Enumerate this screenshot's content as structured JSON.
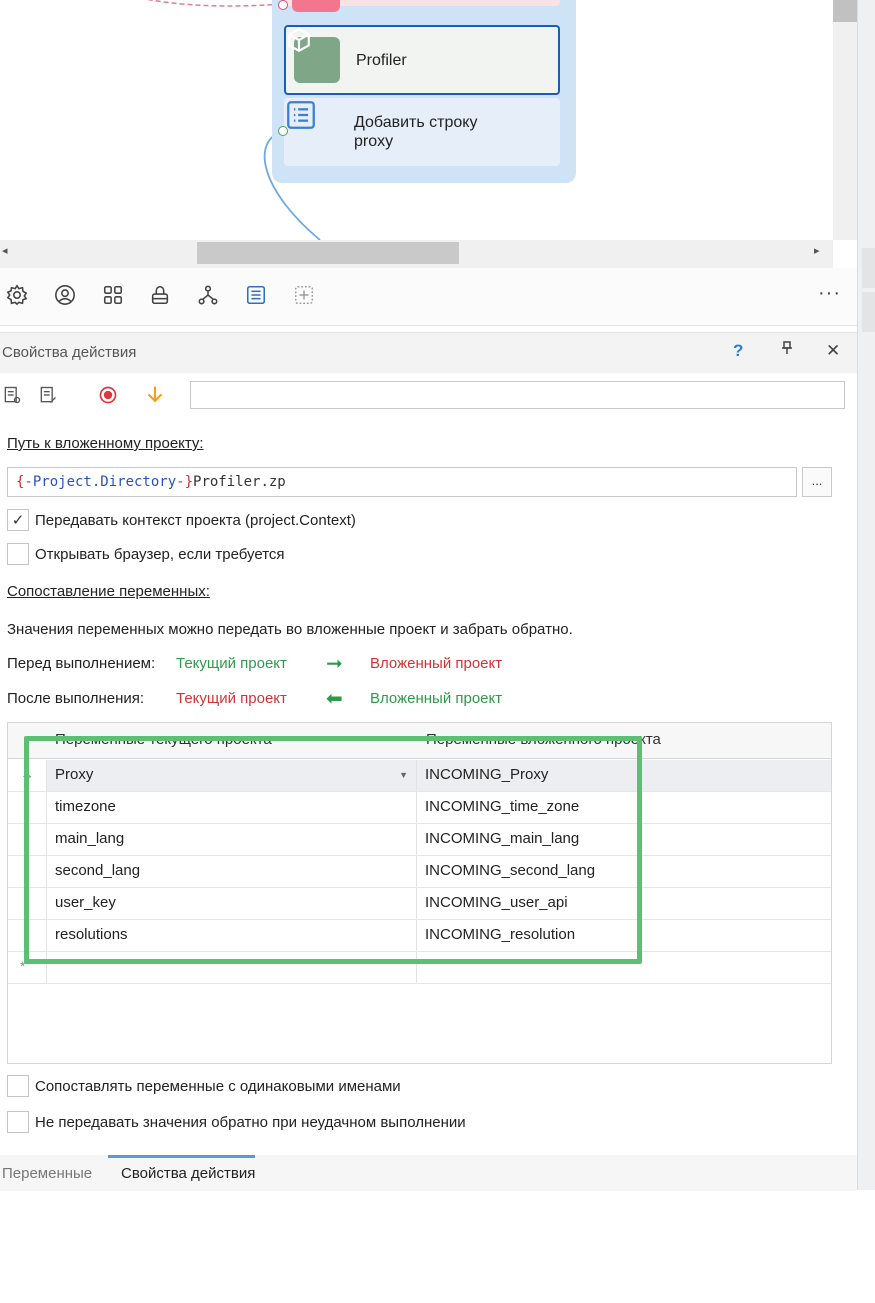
{
  "canvas": {
    "nodes": [
      {
        "title": "Profiler",
        "icon": "cube-icon"
      },
      {
        "title": "Добавить строку\nproxy",
        "icon": "list-icon"
      }
    ]
  },
  "toolbar": {
    "icons": [
      "gear-icon",
      "user-circle-icon",
      "grid-icon",
      "lock-icon",
      "branch-icon",
      "list-box-icon",
      "add-box-icon"
    ],
    "more": "···"
  },
  "panel": {
    "title": "Свойства действия",
    "help": "?",
    "pin": "ᵽ",
    "close": "✕",
    "sub_icons": [
      "action-settings-icon",
      "action-edit-icon",
      "record-icon",
      "arrow-down-icon"
    ],
    "action_name": "",
    "path_label": "Путь к вложенному проекту:",
    "path_value": {
      "open_brace": "{-",
      "variable": "Project.Directory",
      "close_brace": "-}",
      "file": "Profiler.zp"
    },
    "browse": "...",
    "options": [
      {
        "label": "Передавать контекст проекта (project.Context)",
        "checked": true
      },
      {
        "label": "Открывать браузер, если требуется",
        "checked": false
      }
    ],
    "mapping_label": "Сопоставление переменных:",
    "mapping_desc": "Значения переменных можно передать во вложенные проект и забрать обратно.",
    "before": {
      "label": "Перед выполнением:",
      "from": "Текущий проект",
      "arrow": "➞",
      "to": "Вложенный проект"
    },
    "after": {
      "label": "После выполнения:",
      "from": "Текущий проект",
      "arrow": "⬅",
      "to": "Вложенный проект"
    },
    "grid": {
      "col_a": "Переменные текущего проекта",
      "col_b": "Переменные вложенного проекта",
      "rows": [
        {
          "a": "Proxy",
          "b": "INCOMING_Proxy"
        },
        {
          "a": "timezone",
          "b": "INCOMING_time_zone"
        },
        {
          "a": "main_lang",
          "b": "INCOMING_main_lang"
        },
        {
          "a": "second_lang",
          "b": "INCOMING_second_lang"
        },
        {
          "a": "user_key",
          "b": "INCOMING_user_api"
        },
        {
          "a": "resolutions",
          "b": "INCOMING_resolution"
        }
      ],
      "new_row_marker": "*",
      "current_row_marker": "→"
    },
    "bottom_options": [
      {
        "label": "Сопоставлять переменные с одинаковыми именами",
        "checked": false
      },
      {
        "label": "Не передавать значения обратно при неудачном выполнении",
        "checked": false
      }
    ],
    "tabs": [
      {
        "label": "Переменные",
        "active": false
      },
      {
        "label": "Свойства действия",
        "active": true
      }
    ]
  },
  "colors": {
    "accent": "#1560bd",
    "highlight": "#5dbf74",
    "green_text": "#2e9b4a",
    "red_text": "#d23434"
  }
}
